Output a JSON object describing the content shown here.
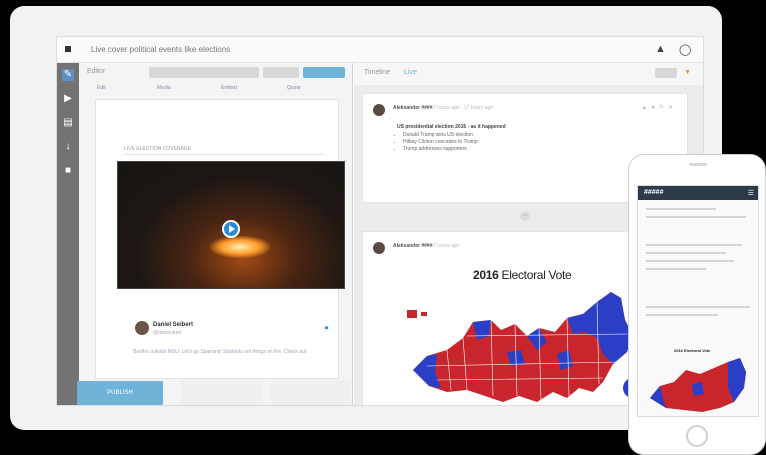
{
  "window": {
    "title": "Live cover political events like elections"
  },
  "editor": {
    "label": "Editor",
    "toolbar": [
      "Edit",
      "Media",
      "Embed",
      "Quote"
    ],
    "caption": "LIVE ELECTION COVERAGE",
    "publish_label": "PUBLISH"
  },
  "tweet": {
    "name": "Daniel Seibert",
    "handle": "@danseibert",
    "text": "Bonfire outside MSU. Let's go Spartans! Students set things on fire. Check out"
  },
  "timeline": {
    "label": "Timeline",
    "live_label": "Live",
    "post1": {
      "author": "Aleksander #### ",
      "meta": "2 hours ago · 17 hours ago",
      "heading": "US presidential election 2016 - as it happened",
      "bullets": [
        "Donald Trump wins US election",
        "Hillary Clinton concedes to Trump",
        "Trump addresses supporters"
      ]
    },
    "post2": {
      "author": "Aleksander ####",
      "meta": "2 hours ago",
      "map_title_bold": "2016",
      "map_title_rest": " Electoral Vote"
    }
  },
  "phone": {
    "brand": "#####",
    "map_title": "2016 Electoral Vote"
  },
  "colors": {
    "accent": "#6fb3d8",
    "sidebar": "#737373",
    "red_state": "#c8262c",
    "blue_state": "#2b3fc6"
  }
}
